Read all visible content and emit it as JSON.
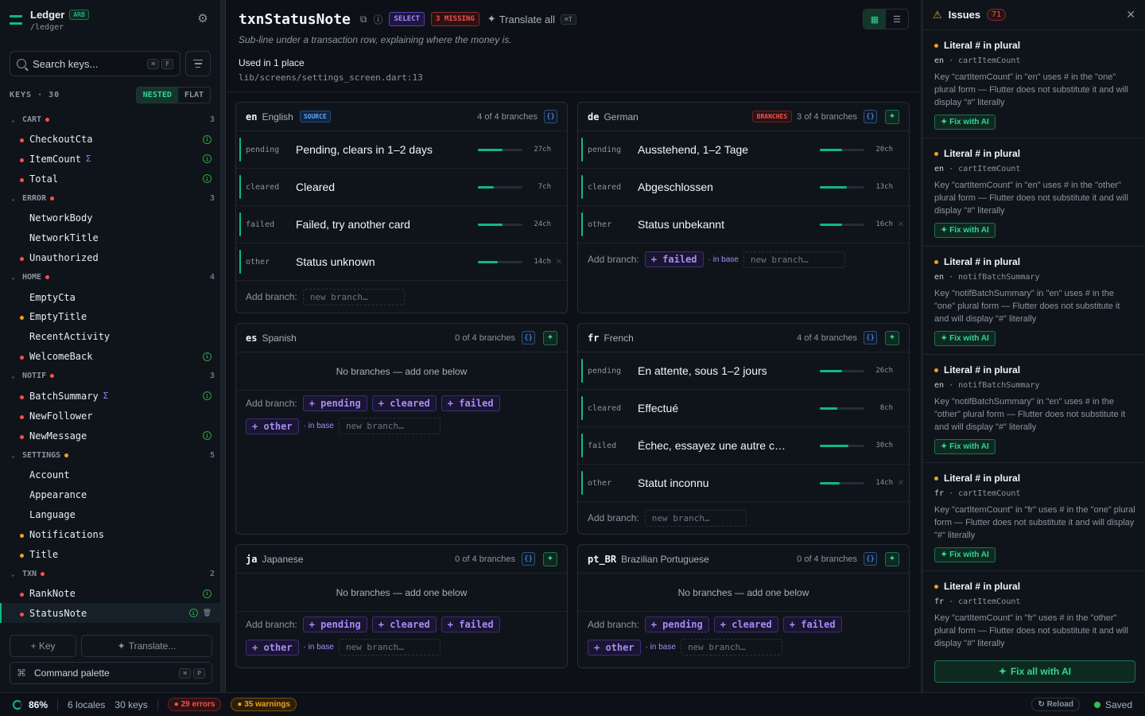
{
  "app": {
    "name": "Ledger",
    "badge": "ARB",
    "path": "/ledger"
  },
  "search": {
    "placeholder": "Search keys...",
    "kbd1": "⌘",
    "kbd2": "F"
  },
  "keys_header": {
    "label": "KEYS · 30",
    "nested": "NESTED",
    "flat": "FLAT",
    "active": "NESTED"
  },
  "tree": [
    {
      "group": "CART",
      "dot": "red",
      "count": "3",
      "keys": [
        {
          "name": "CheckoutCta",
          "dot": "red",
          "info": true
        },
        {
          "name": "ItemCount",
          "dot": "red",
          "sigma": "Σ",
          "info": true
        },
        {
          "name": "Total",
          "dot": "red",
          "info": true
        }
      ]
    },
    {
      "group": "ERROR",
      "dot": "red",
      "count": "3",
      "keys": [
        {
          "name": "NetworkBody",
          "dot": ""
        },
        {
          "name": "NetworkTitle",
          "dot": ""
        },
        {
          "name": "Unauthorized",
          "dot": "red"
        }
      ]
    },
    {
      "group": "HOME",
      "dot": "red",
      "count": "4",
      "keys": [
        {
          "name": "EmptyCta",
          "dot": ""
        },
        {
          "name": "EmptyTitle",
          "dot": "amber"
        },
        {
          "name": "RecentActivity",
          "dot": ""
        },
        {
          "name": "WelcomeBack",
          "dot": "red",
          "info": true
        }
      ]
    },
    {
      "group": "NOTIF",
      "dot": "red",
      "count": "3",
      "keys": [
        {
          "name": "BatchSummary",
          "dot": "red",
          "sigma": "Σ",
          "info": true
        },
        {
          "name": "NewFollower",
          "dot": "red"
        },
        {
          "name": "NewMessage",
          "dot": "red",
          "info": true
        }
      ]
    },
    {
      "group": "SETTINGS",
      "dot": "amber",
      "count": "5",
      "keys": [
        {
          "name": "Account",
          "dot": ""
        },
        {
          "name": "Appearance",
          "dot": ""
        },
        {
          "name": "Language",
          "dot": ""
        },
        {
          "name": "Notifications",
          "dot": "amber"
        },
        {
          "name": "Title",
          "dot": "amber"
        }
      ]
    },
    {
      "group": "TXN",
      "dot": "red",
      "count": "2",
      "keys": [
        {
          "name": "RankNote",
          "dot": "red",
          "info": true
        },
        {
          "name": "StatusNote",
          "dot": "red",
          "info": true,
          "selected": true
        }
      ]
    }
  ],
  "sidebar_footer": {
    "add_key": "+ Key",
    "translate": "Translate...",
    "command_palette": "Command palette",
    "kbd1": "⌘",
    "kbd2": "P"
  },
  "header": {
    "key_title": "txnStatusNote",
    "select_tag": "SELECT",
    "missing_tag": "3 MISSING",
    "translate_all": "Translate all",
    "translate_all_kbd": "⌘T",
    "description": "Sub-line under a transaction row, explaining where the money is.",
    "used_in": "Used in 1 place",
    "used_path": "lib/screens/settings_screen.dart:13"
  },
  "labels": {
    "add_branch": "Add branch:",
    "new_branch": "new branch…",
    "in_base": "· in base",
    "no_branches": "No branches — add one below"
  },
  "locales": [
    {
      "code": "en",
      "name": "English",
      "source": "SOURCE",
      "count": "4 of 4 branches",
      "sparkle": false,
      "branches": [
        {
          "case": "pending",
          "text": "Pending, clears in 1–2 days",
          "chars": "27ch",
          "fill": 0.55
        },
        {
          "case": "cleared",
          "text": "Cleared",
          "chars": "7ch",
          "fill": 0.35
        },
        {
          "case": "failed",
          "text": "Failed, try another card",
          "chars": "24ch",
          "fill": 0.55
        },
        {
          "case": "other",
          "text": "Status unknown",
          "chars": "14ch",
          "fill": 0.45,
          "remove": true
        }
      ],
      "chips": []
    },
    {
      "code": "de",
      "name": "German",
      "warn": "BRANCHES",
      "count": "3 of 4 branches",
      "sparkle": true,
      "branches": [
        {
          "case": "pending",
          "text": "Ausstehend, 1–2 Tage",
          "chars": "20ch",
          "fill": 0.5
        },
        {
          "case": "cleared",
          "text": "Abgeschlossen",
          "chars": "13ch",
          "fill": 0.6
        },
        {
          "case": "other",
          "text": "Status unbekannt",
          "chars": "16ch",
          "fill": 0.5,
          "remove": true
        }
      ],
      "chips": [
        "+ failed"
      ]
    },
    {
      "code": "es",
      "name": "Spanish",
      "count": "0 of 4 branches",
      "sparkle": true,
      "branches": [],
      "chips": [
        "+ pending",
        "+ cleared",
        "+ failed",
        "+ other"
      ]
    },
    {
      "code": "fr",
      "name": "French",
      "count": "4 of 4 branches",
      "sparkle": true,
      "branches": [
        {
          "case": "pending",
          "text": "En attente, sous 1–2 jours",
          "chars": "26ch",
          "fill": 0.5
        },
        {
          "case": "cleared",
          "text": "Effectué",
          "chars": "8ch",
          "fill": 0.4
        },
        {
          "case": "failed",
          "text": "Échec, essayez une autre c…",
          "chars": "30ch",
          "fill": 0.65
        },
        {
          "case": "other",
          "text": "Statut inconnu",
          "chars": "14ch",
          "fill": 0.45,
          "remove": true
        }
      ],
      "chips": []
    },
    {
      "code": "ja",
      "name": "Japanese",
      "count": "0 of 4 branches",
      "sparkle": true,
      "branches": [],
      "chips": [
        "+ pending",
        "+ cleared",
        "+ failed",
        "+ other"
      ]
    },
    {
      "code": "pt_BR",
      "name": "Brazilian Portuguese",
      "count": "0 of 4 branches",
      "sparkle": true,
      "branches": [],
      "chips": [
        "+ pending",
        "+ cleared",
        "+ failed",
        "+ other"
      ]
    }
  ],
  "issues": {
    "title": "Issues",
    "count": "71",
    "fix_label": "Fix with AI",
    "fix_all": "Fix all with AI",
    "items": [
      {
        "title": "Literal # in plural",
        "locale": "en",
        "key": "cartItemCount",
        "desc": "Key \"cartItemCount\" in \"en\" uses # in the \"one\" plural form — Flutter does not substitute it and will display \"#\" literally"
      },
      {
        "title": "Literal # in plural",
        "locale": "en",
        "key": "cartItemCount",
        "desc": "Key \"cartItemCount\" in \"en\" uses # in the \"other\" plural form — Flutter does not substitute it and will display \"#\" literally"
      },
      {
        "title": "Literal # in plural",
        "locale": "en",
        "key": "notifBatchSummary",
        "desc": "Key \"notifBatchSummary\" in \"en\" uses # in the \"one\" plural form — Flutter does not substitute it and will display \"#\" literally"
      },
      {
        "title": "Literal # in plural",
        "locale": "en",
        "key": "notifBatchSummary",
        "desc": "Key \"notifBatchSummary\" in \"en\" uses # in the \"other\" plural form — Flutter does not substitute it and will display \"#\" literally"
      },
      {
        "title": "Literal # in plural",
        "locale": "fr",
        "key": "cartItemCount",
        "desc": "Key \"cartItemCount\" in \"fr\" uses # in the \"one\" plural form — Flutter does not substitute it and will display \"#\" literally"
      },
      {
        "title": "Literal # in plural",
        "locale": "fr",
        "key": "cartItemCount",
        "desc": "Key \"cartItemCount\" in \"fr\" uses # in the \"other\" plural form — Flutter does not substitute it and will display \"#\" literally"
      }
    ]
  },
  "status": {
    "progress": "86%",
    "progress_value": 0.86,
    "locales": "6 locales",
    "keys": "30 keys",
    "errors": "● 29 errors",
    "warnings": "● 35 warnings",
    "reload": "↻ Reload",
    "saved": "Saved"
  },
  "colors": {
    "accent": "#10b981",
    "error": "#f85149",
    "warning": "#f0a020",
    "violet": "#a78bfa",
    "blue": "#58a6ff"
  }
}
